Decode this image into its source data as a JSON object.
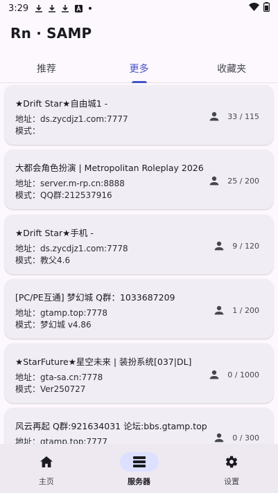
{
  "status_bar": {
    "time": "3:29",
    "icons": [
      "download-icon",
      "download-icon",
      "download-icon",
      "a-icon",
      "dot-icon",
      "wifi-icon",
      "battery-icon"
    ]
  },
  "app": {
    "title": "Rn · SAMP"
  },
  "tabs": [
    {
      "label": "推荐",
      "active": false
    },
    {
      "label": "更多",
      "active": true
    },
    {
      "label": "收藏夹",
      "active": false
    }
  ],
  "servers": [
    {
      "name": "★Drift Star★自由城1 -",
      "address": "地址：ds.zycdjz1.com:7777",
      "mode": "模式：",
      "players": "33 / 115"
    },
    {
      "name": "大都会角色扮演 | Metropolitan Roleplay 2026",
      "address": "地址：server.m-rp.cn:8888",
      "mode": "模式：QQ群:212537916",
      "players": "25 / 200"
    },
    {
      "name": "★Drift Star★手机 -",
      "address": "地址：ds.zycdjz1.com:7778",
      "mode": "模式：教父4.6",
      "players": "9 / 120"
    },
    {
      "name": "[PC/PE互通] 梦幻城 Q群：1033687209",
      "address": "地址：gtamp.top:7778",
      "mode": "模式：梦幻城 v4.86",
      "players": "1 / 200"
    },
    {
      "name": "★StarFuture★星空未来 | 装扮系统[037|DL]",
      "address": "地址：gta-sa.cn:7778",
      "mode": "模式：Ver250727",
      "players": "0 / 1000"
    },
    {
      "name": "风云再起 Q群:921634031 论坛:bbs.gtamp.top",
      "address": "地址：gtamp.top:7777",
      "mode": "",
      "players": "0 / 300"
    }
  ],
  "bottom_nav": [
    {
      "label": "主页",
      "icon": "home-icon",
      "active": false
    },
    {
      "label": "服务器",
      "icon": "server-list-icon",
      "active": true
    },
    {
      "label": "设置",
      "icon": "settings-icon",
      "active": false
    }
  ],
  "colors": {
    "accent": "#4452c8",
    "card_bg": "#f0edf4",
    "nav_active_bg": "#dde0ff"
  }
}
